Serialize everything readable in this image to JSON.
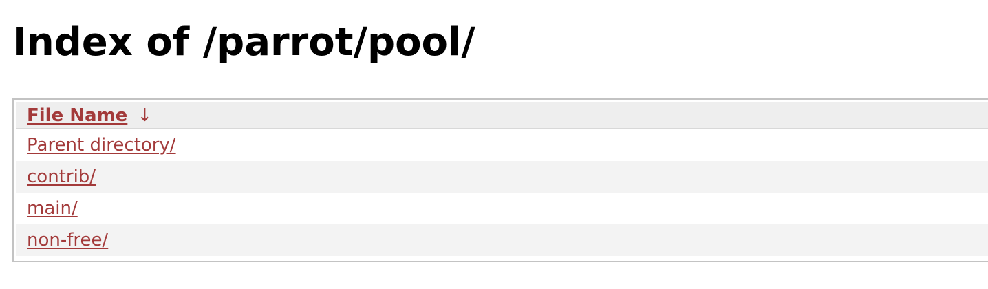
{
  "page": {
    "title": "Index of /parrot/pool/"
  },
  "listing": {
    "header": {
      "label": "File Name",
      "sort_arrow": "↓"
    },
    "entries": [
      {
        "label": "Parent directory/"
      },
      {
        "label": "contrib/"
      },
      {
        "label": "main/"
      },
      {
        "label": "non-free/"
      }
    ]
  },
  "colors": {
    "link": "#a33a3a",
    "header_bg": "#eeeeee",
    "row_alt_bg": "#f3f3f3",
    "border": "#c3c3c3"
  }
}
